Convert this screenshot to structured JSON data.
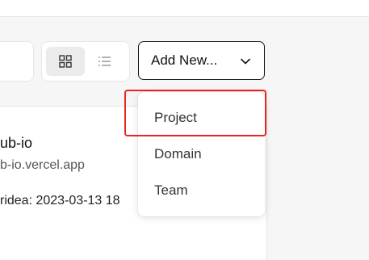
{
  "toolbar": {
    "add_new_label": "Add New...",
    "view_grid_icon": "grid-icon",
    "view_list_icon": "list-icon",
    "chevron_icon": "chevron-down-icon"
  },
  "dropdown": {
    "items": [
      {
        "label": "Project"
      },
      {
        "label": "Domain"
      },
      {
        "label": "Team"
      }
    ],
    "highlighted_item": "Project",
    "highlight_color": "#e8261f"
  },
  "card": {
    "title": "ub-io",
    "url": "b-io.vercel.app",
    "meta": "ridea: 2023-03-13 18"
  }
}
